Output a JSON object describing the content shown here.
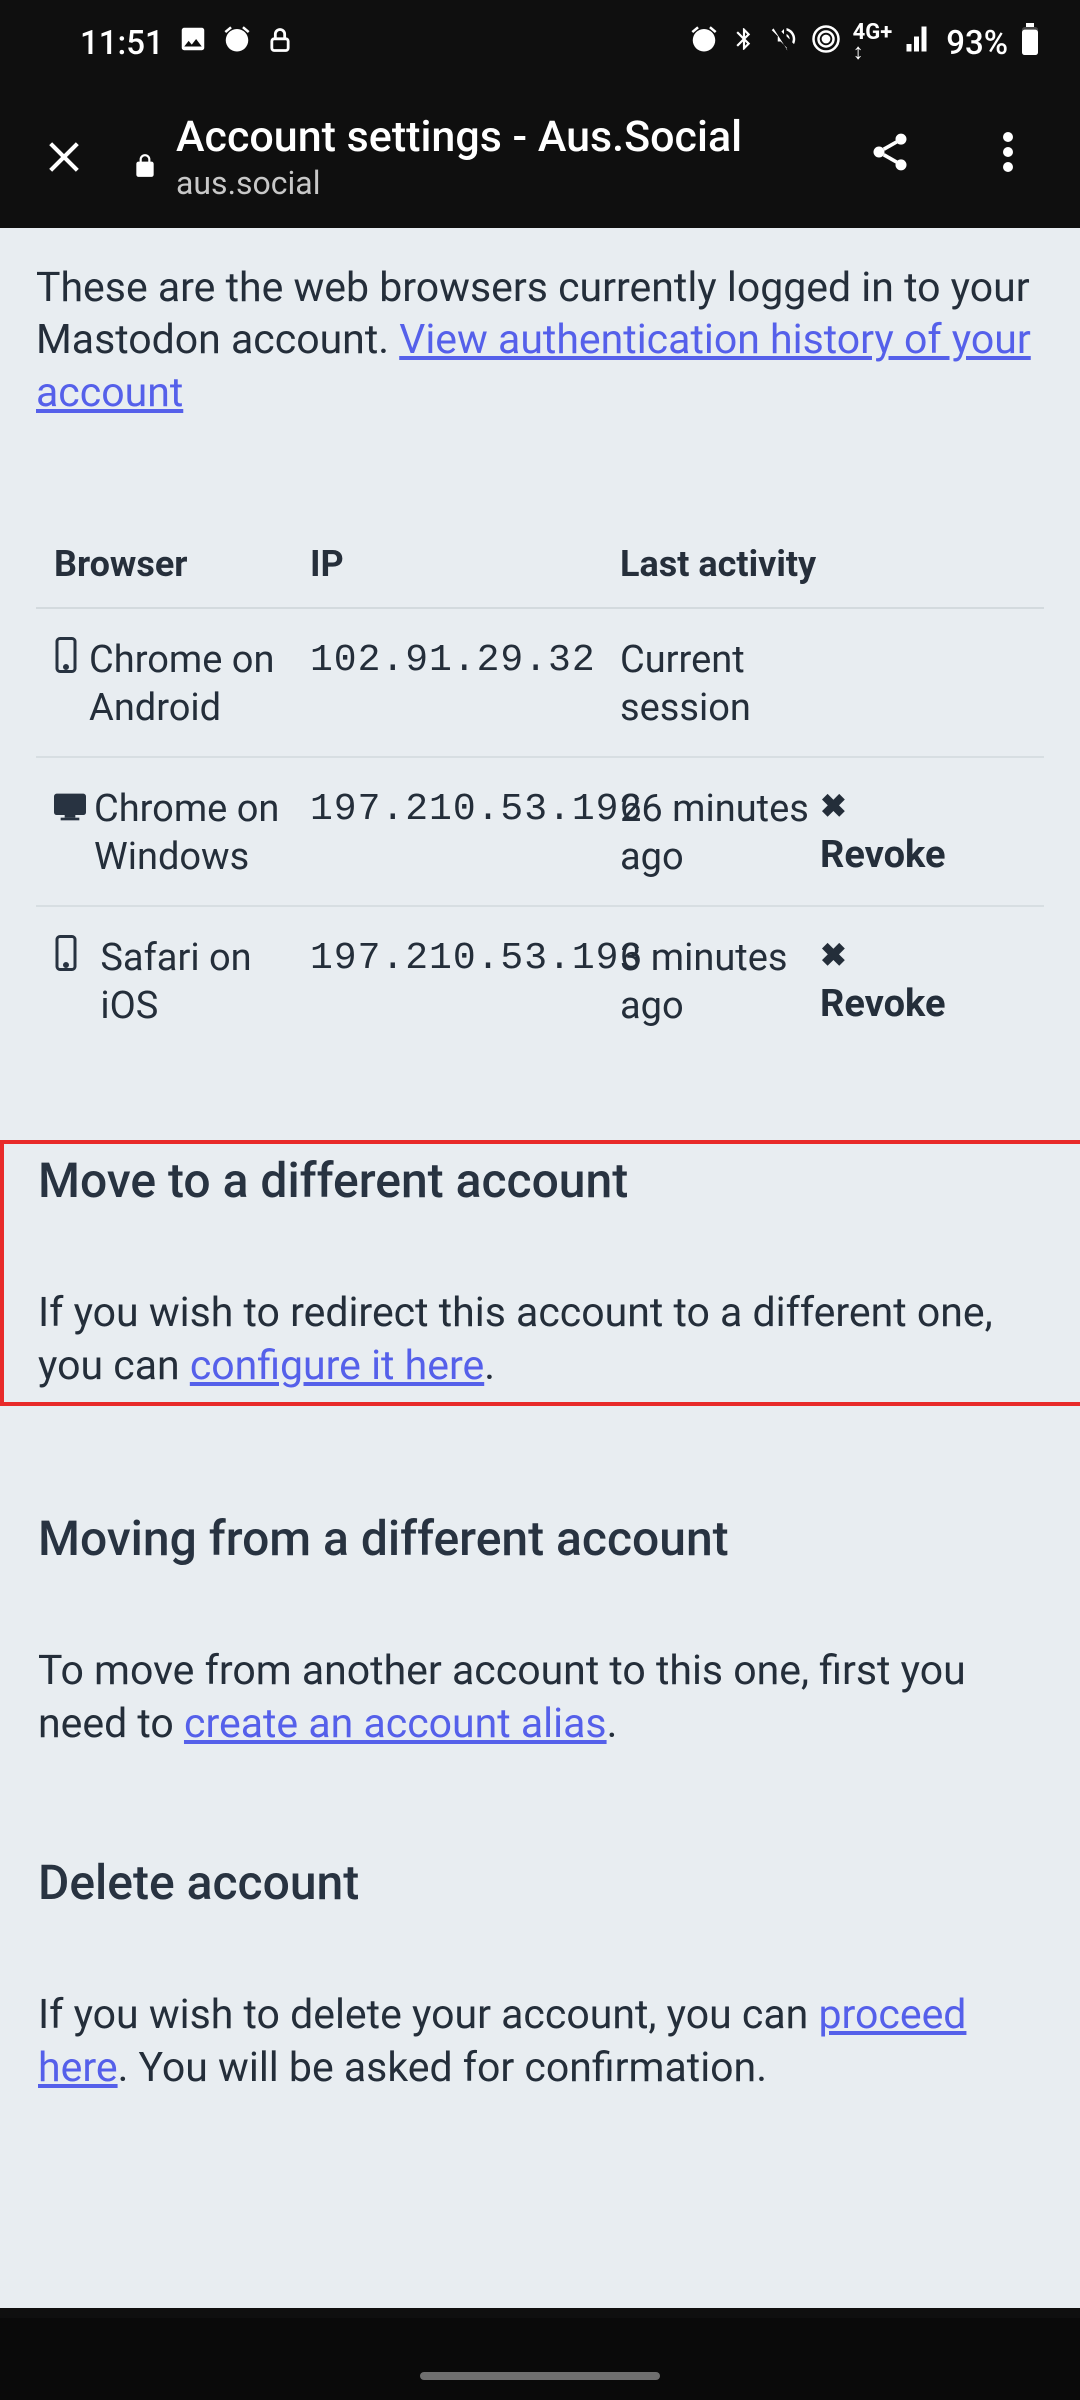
{
  "status": {
    "time": "11:51",
    "battery": "93%"
  },
  "browser_bar": {
    "page_title": "Account settings - Aus.Social",
    "domain": "aus.social"
  },
  "intro": {
    "text_pre": "These are the web browsers currently logged in to your Mastodon account. ",
    "link": "View authentication history of your account"
  },
  "table": {
    "headers": {
      "browser": "Browser",
      "ip": "IP",
      "activity": "Last activity"
    },
    "rows": [
      {
        "icon": "phone",
        "browser": "Chrome on Android",
        "ip": "102.91.29.32",
        "activity": "Current session",
        "revoke": ""
      },
      {
        "icon": "desktop",
        "browser": "Chrome on Windows",
        "ip": "197.210.53.196",
        "activity": "26 minutes ago",
        "revoke": "Revoke"
      },
      {
        "icon": "phone",
        "browser": "Safari on iOS",
        "ip": "197.210.53.196",
        "activity": "3 minutes ago",
        "revoke": "Revoke"
      }
    ]
  },
  "sections": {
    "move_to": {
      "title": "Move to a different account",
      "text_pre": "If you wish to redirect this account to a different one, you can ",
      "link": "configure it here",
      "text_post": "."
    },
    "move_from": {
      "title": "Moving from a different account",
      "text_pre": "To move from another account to this one, first you need to ",
      "link": "create an account alias",
      "text_post": "."
    },
    "delete": {
      "title": "Delete account",
      "text_pre": "If you wish to delete your account, you can ",
      "link": "proceed here",
      "text_post": ". You will be asked for confirmation."
    }
  }
}
